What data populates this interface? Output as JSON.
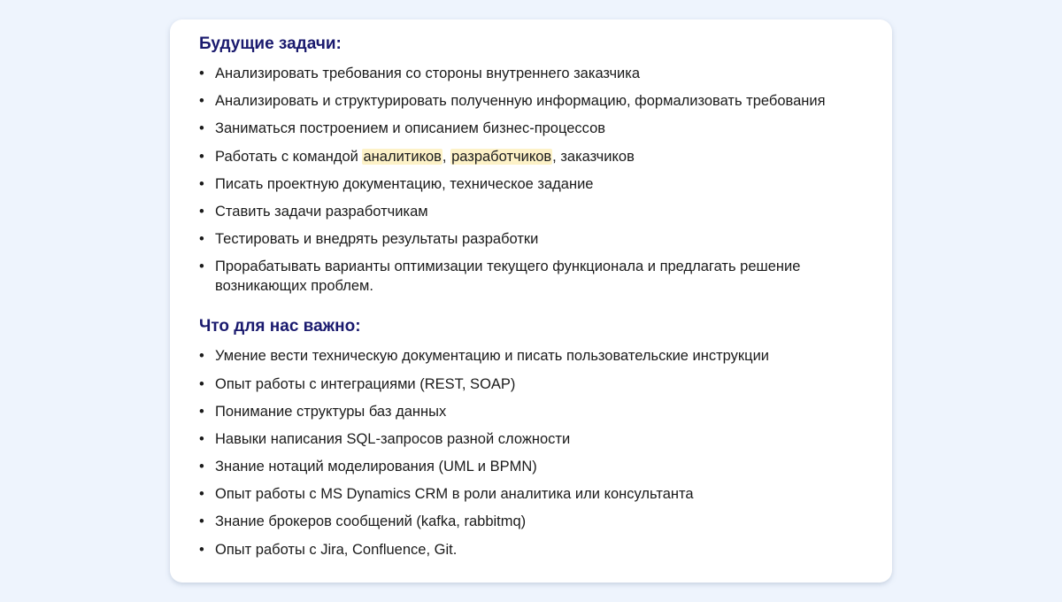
{
  "future_tasks": {
    "title": "Будущие задачи:",
    "items": [
      "Анализировать требования со стороны внутреннего заказчика",
      "Анализировать и структурировать полученную информацию, формализовать требования",
      "Заниматься построением и описанием бизнес-процессов",
      "Работать с командой аналитиков, разработчиков, заказчиков",
      "Писать проектную документацию, техническое задание",
      "Ставить задачи разработчикам",
      "Тестировать и внедрять результаты разработки",
      "Прорабатывать варианты оптимизации текущего функционала и предлагать решение возникающих проблем."
    ],
    "item_4_parts": {
      "prefix": "Работать с командой ",
      "highlight_1": "аналитиков",
      "sep": ", ",
      "highlight_2": "разработчиков",
      "suffix": ", заказчиков"
    },
    "highlight_color": "#fdf2c8"
  },
  "requirements": {
    "title": "Что для нас важно:",
    "items": [
      "Умение вести техническую документацию и писать пользовательские инструкции",
      "Опыт работы с интеграциями (REST, SOAP)",
      "Понимание структуры баз данных",
      "Навыки написания SQL-запросов разной сложности",
      "Знание нотаций моделирования (UML и BPMN)",
      "Опыт работы с MS Dynamics CRM в роли аналитика или консультанта",
      "Знание брокеров сообщений (kafka, rabbitmq)",
      "Опыт работы с Jira, Confluence, Git."
    ]
  },
  "bullet": "•",
  "colors": {
    "background": "#eef4fd",
    "card": "#ffffff",
    "heading": "#1a1a6e",
    "text": "#1b1b1b"
  }
}
